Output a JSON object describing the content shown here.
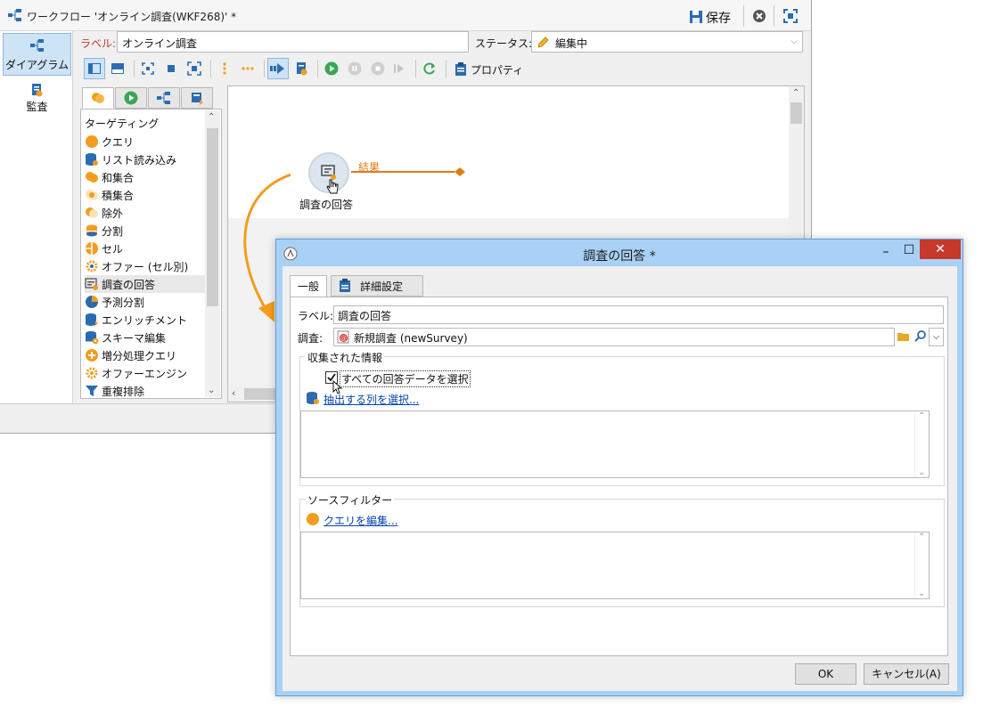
{
  "main_window": {
    "title": "ワークフロー 'オンライン調査(WKF268)' *",
    "save_label": "保存",
    "label_field_label": "ラベル:",
    "label_value": "オンライン調査",
    "status_label": "ステータス:",
    "status_value": "編集中",
    "properties_label": "プロパティ"
  },
  "left_nav": {
    "items": [
      {
        "label": "ダイアグラム"
      },
      {
        "label": "監査"
      }
    ]
  },
  "palette": {
    "heading": "ターゲティング",
    "items": [
      {
        "label": "クエリ"
      },
      {
        "label": "リスト読み込み"
      },
      {
        "label": "和集合"
      },
      {
        "label": "積集合"
      },
      {
        "label": "除外"
      },
      {
        "label": "分割"
      },
      {
        "label": "セル"
      },
      {
        "label": "オファー (セル別)"
      },
      {
        "label": "調査の回答"
      },
      {
        "label": "予測分割"
      },
      {
        "label": "エンリッチメント"
      },
      {
        "label": "スキーマ編集"
      },
      {
        "label": "増分処理クエリ"
      },
      {
        "label": "オファーエンジン"
      },
      {
        "label": "重複排除"
      }
    ]
  },
  "canvas": {
    "node_label": "調査の回答",
    "output_label": "結果"
  },
  "dialog": {
    "title": "調査の回答 *",
    "tabs": [
      {
        "label": "一般"
      },
      {
        "label": "詳細設定"
      }
    ],
    "label_field_label": "ラベル:",
    "label_value": "調査の回答",
    "survey_field_label": "調査:",
    "survey_value": "新規調査 (newSurvey)",
    "collected_group_title": "収集された情報",
    "select_all_checkbox_label": "すべての回答データを選択",
    "select_columns_link": "抽出する列を選択...",
    "source_filter_title": "ソースフィルター",
    "edit_query_link": "クエリを編集...",
    "ok_label": "OK",
    "cancel_label": "キャンセル(A)"
  },
  "colors": {
    "accent_orange": "#f39c1f",
    "link_blue": "#0645ad",
    "close_red": "#c7392b",
    "dialog_frame": "#a9d1f5"
  }
}
